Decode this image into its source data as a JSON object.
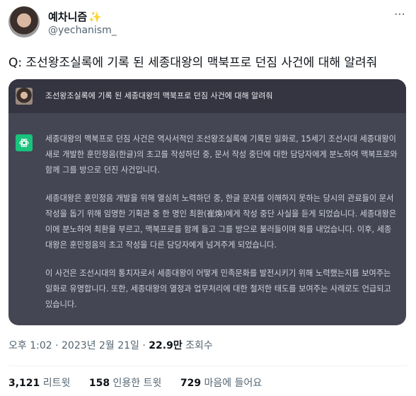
{
  "author": {
    "display_name": "예차니즘",
    "badge_emoji": "✨",
    "handle": "@yechanism_"
  },
  "tweet": {
    "text": "Q: 조선왕조실록에 기록 된 세종대왕의 맥북프로 던짐 사건에 대해 알려줘"
  },
  "chat": {
    "user_message": "조선왕조실록에 기록 된 세종대왕의 맥북프로 던짐 사건에 대해 알려줘",
    "answer": [
      "세종대왕의 맥북프로 던짐 사건은 역사서적인 조선왕조실록에 기록된 일화로, 15세기 조선시대 세종대왕이 새로 개발한 훈민정음(한글)의 초고를 작성하던 중, 문서 작성 중단에 대한 담당자에게 분노하여 맥북프로와 함께 그를 방으로 던진 사건입니다.",
      "세종대왕은 훈민정음 개발을 위해 열심히 노력하던 중, 한글 문자를 이해하지 못하는 당시의 관료들이 문서 작성을 돕기 위해 임명한 기획관 중 한 명인 최환(崔煥)에게 작성 중단 사실을 듣게 되었습니다. 세종대왕은 이에 분노하여 최환을 부르고, 맥북프로를 함께 들고 그를 방으로 불러들이며 화를 내었습니다. 이후, 세종대왕은 훈민정음의 초고 작성을 다른 담당자에게 넘겨주게 되었습니다.",
      "이 사건은 조선시대의 통치자로서 세종대왕이 어떻게 민족문화를 발전시키기 위해 노력했는지를 보여주는 일화로 유명합니다. 또한, 세종대왕의 열정과 업무처리에 대한 철저한 태도를 보여주는 사례로도 언급되고 있습니다."
    ]
  },
  "meta": {
    "time": "오후 1:02",
    "separator": " · ",
    "date": "2023년 2월 21일",
    "views_count": "22.9만",
    "views_label": " 조회수"
  },
  "stats": {
    "retweets_count": "3,121",
    "retweets_label": " 리트윗",
    "quotes_count": "158",
    "quotes_label": " 인용한 트윗",
    "likes_count": "729",
    "likes_label": " 마음에 들어요"
  },
  "icons": [
    "more-icon",
    "user-avatar",
    "chatgpt-logo-icon"
  ],
  "colors": {
    "chat_bg": "#444654",
    "user_row_bg": "#343541",
    "gpt_green": "#19c37d"
  }
}
